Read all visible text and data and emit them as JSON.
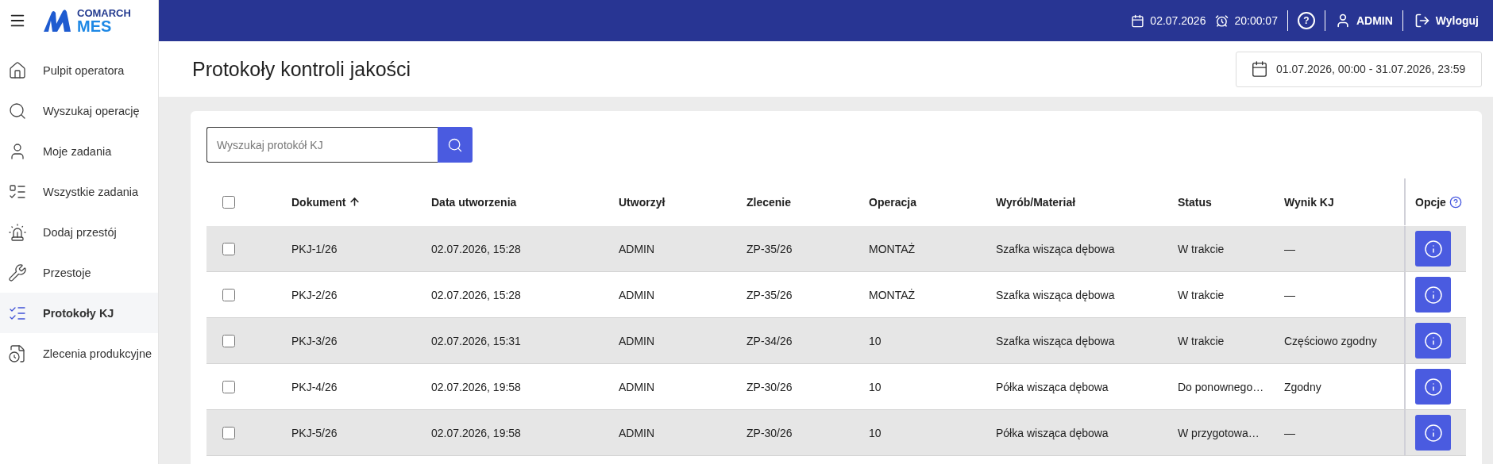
{
  "brand": {
    "company": "COMARCH",
    "product": "MES"
  },
  "topbar": {
    "date": "02.07.2026",
    "time": "20:00:07",
    "help": "?",
    "user": "ADMIN",
    "logout": "Wyloguj"
  },
  "sidebar": {
    "items": [
      {
        "label": "Pulpit operatora",
        "selected": false
      },
      {
        "label": "Wyszukaj operację",
        "selected": false
      },
      {
        "label": "Moje zadania",
        "selected": false
      },
      {
        "label": "Wszystkie zadania",
        "selected": false
      },
      {
        "label": "Dodaj przestój",
        "selected": false
      },
      {
        "label": "Przestoje",
        "selected": false
      },
      {
        "label": "Protokoły KJ",
        "selected": true
      },
      {
        "label": "Zlecenia produkcyjne",
        "selected": false
      }
    ]
  },
  "page": {
    "title": "Protokoły kontroli jakości",
    "date_range": "01.07.2026, 00:00 - 31.07.2026, 23:59"
  },
  "search": {
    "placeholder": "Wyszukaj protokół KJ"
  },
  "table": {
    "select_all_checked": false,
    "columns": [
      {
        "label": "Dokument",
        "sorted": true
      },
      {
        "label": "Data utworzenia",
        "sorted": false
      },
      {
        "label": "Utworzył",
        "sorted": false
      },
      {
        "label": "Zlecenie",
        "sorted": false
      },
      {
        "label": "Operacja",
        "sorted": false
      },
      {
        "label": "Wyrób/Materiał",
        "sorted": false
      },
      {
        "label": "Status",
        "sorted": false
      },
      {
        "label": "Wynik KJ",
        "sorted": false
      },
      {
        "label": "Opcje",
        "sorted": false
      }
    ],
    "rows": [
      {
        "checked": false,
        "cells": [
          "PKJ-1/26",
          "02.07.2026, 15:28",
          "ADMIN",
          "ZP-35/26",
          "MONTAŻ",
          "Szafka wisząca dębowa",
          "W trakcie",
          "—"
        ]
      },
      {
        "checked": false,
        "cells": [
          "PKJ-2/26",
          "02.07.2026, 15:28",
          "ADMIN",
          "ZP-35/26",
          "MONTAŻ",
          "Szafka wisząca dębowa",
          "W trakcie",
          "—"
        ]
      },
      {
        "checked": false,
        "cells": [
          "PKJ-3/26",
          "02.07.2026, 15:31",
          "ADMIN",
          "ZP-34/26",
          "10",
          "Szafka wisząca dębowa",
          "W trakcie",
          "Częściowo zgodny"
        ]
      },
      {
        "checked": false,
        "cells": [
          "PKJ-4/26",
          "02.07.2026, 19:58",
          "ADMIN",
          "ZP-30/26",
          "10",
          "Półka wisząca dębowa",
          "Do ponownego…",
          "Zgodny"
        ]
      },
      {
        "checked": false,
        "cells": [
          "PKJ-5/26",
          "02.07.2026, 19:58",
          "ADMIN",
          "ZP-30/26",
          "10",
          "Półka wisząca dębowa",
          "W przygotowa…",
          "—"
        ]
      }
    ]
  }
}
